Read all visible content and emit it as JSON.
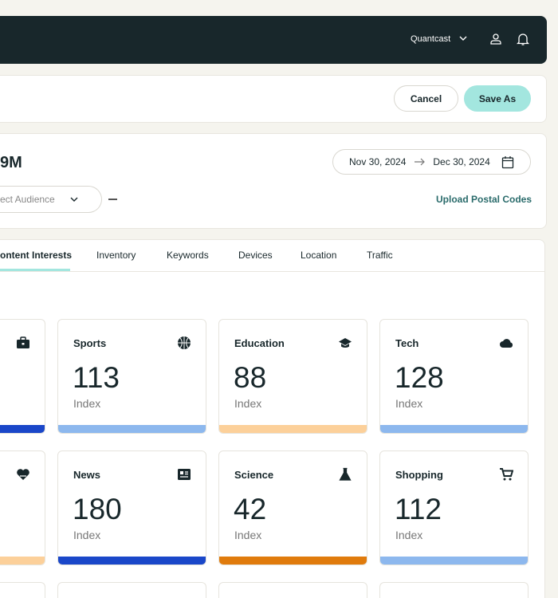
{
  "header": {
    "account": "Quantcast"
  },
  "actions": {
    "cancel": "Cancel",
    "save_as": "Save As"
  },
  "summary": {
    "reach": "9M",
    "date_start": "Nov 30, 2024",
    "date_end": "Dec 30, 2024",
    "audience_placeholder": "ect Audience",
    "upload": "Upload Postal Codes"
  },
  "tabs": [
    "ontent Interests",
    "Inventory",
    "Keywords",
    "Devices",
    "Location",
    "Traffic"
  ],
  "tiles": [
    {
      "title": "",
      "value": "",
      "label": "",
      "icon": "briefcase-icon",
      "color": "#1a47c9"
    },
    {
      "title": "Sports",
      "value": "113",
      "label": "Index",
      "icon": "basketball-icon",
      "color": "#8db8ee"
    },
    {
      "title": "Education",
      "value": "88",
      "label": "Index",
      "icon": "graduation-cap-icon",
      "color": "#fcd09a"
    },
    {
      "title": "Tech",
      "value": "128",
      "label": "Index",
      "icon": "cloud-icon",
      "color": "#8db8ee"
    },
    {
      "title": "",
      "value": "",
      "label": "",
      "icon": "heart-icon",
      "color": "#fcd09a"
    },
    {
      "title": "News",
      "value": "180",
      "label": "Index",
      "icon": "newspaper-icon",
      "color": "#1a47c9"
    },
    {
      "title": "Science",
      "value": "42",
      "label": "Index",
      "icon": "flask-icon",
      "color": "#e07b0c"
    },
    {
      "title": "Shopping",
      "value": "112",
      "label": "Index",
      "icon": "cart-icon",
      "color": "#8db8ee"
    }
  ]
}
